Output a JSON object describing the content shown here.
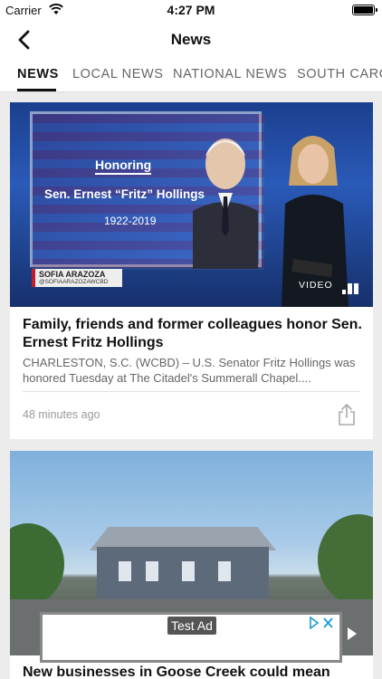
{
  "status_bar": {
    "carrier": "Carrier",
    "time": "4:27 PM"
  },
  "navbar": {
    "title": "News"
  },
  "tabs": [
    {
      "label": "NEWS",
      "active": true
    },
    {
      "label": "LOCAL NEWS",
      "active": false
    },
    {
      "label": "NATIONAL NEWS",
      "active": false
    },
    {
      "label": "SOUTH CARO",
      "active": false
    }
  ],
  "articles": [
    {
      "thumbnail": {
        "graphic_heading": "Honoring",
        "graphic_name": "Sen. Ernest “Fritz” Hollings",
        "graphic_years": "1922-2019",
        "lower_third_name": "SOFIA ARAZOZA",
        "lower_third_handle": "@SOFIAARAZOZAWCBD",
        "media_label": "VIDEO"
      },
      "title": "Family, friends and former colleagues honor Sen. Ernest Fritz Hollings",
      "description": "CHARLESTON, S.C. (WCBD) – U.S. Senator Fritz Hollings was honored Tuesday at The Citadel's Summerall Chapel....",
      "time": "48 minutes ago"
    },
    {
      "title": "New businesses in Goose Creek could mean"
    }
  ],
  "ad": {
    "label": "Test Ad"
  },
  "colors": {
    "accent": "#111111",
    "lower_third_red": "#c51c2c",
    "muted_text": "#666666"
  }
}
